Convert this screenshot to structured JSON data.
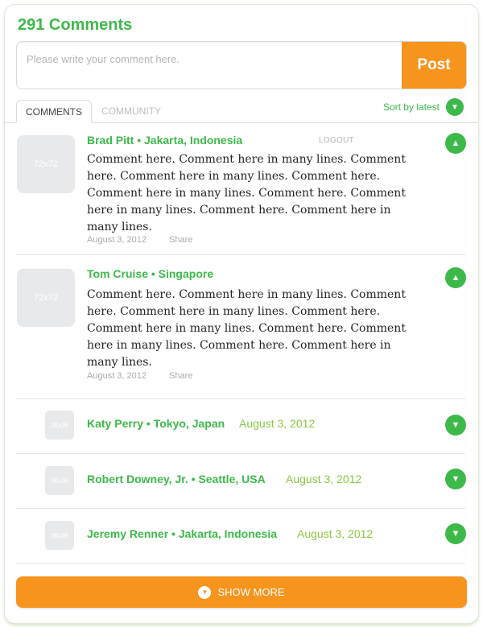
{
  "header": {
    "title": "291 Comments"
  },
  "composer": {
    "placeholder": "Please write your comment here.",
    "post_label": "Post"
  },
  "tabs": [
    {
      "label": "COMMENTS",
      "active": true
    },
    {
      "label": "COMMUNITY",
      "active": false
    }
  ],
  "sort": {
    "label": "Sort by latest",
    "icon": "chevron-down-icon"
  },
  "comments": [
    {
      "avatar": "72x72",
      "author": "Brad Pitt • Jakarta, Indonesia",
      "logout": "LOGOUT",
      "text": "Comment here. Comment here in many lines. Comment here. Comment here in many lines. Comment here. Comment here in many lines. Comment here. Comment here in many lines. Comment here. Comment here in many lines.",
      "date": "August 3, 2012",
      "share": "Share",
      "vote_icon": "up-icon"
    },
    {
      "avatar": "72x72",
      "author": "Tom Cruise • Singapore",
      "text": "Comment here. Comment here in many lines. Comment here. Comment here in many lines. Comment here. Comment here in many lines. Comment here. Comment here in many lines. Comment here. Comment here in many lines.",
      "date": "August 3, 2012",
      "share": "Share",
      "vote_icon": "up-icon"
    }
  ],
  "replies": [
    {
      "avatar": "36x36",
      "author": "Katy Perry • Tokyo, Japan",
      "date": "August 3, 2012",
      "vote_icon": "down-icon"
    },
    {
      "avatar": "36x36",
      "author": "Robert Downey, Jr. • Seattle, USA",
      "date": "August 3, 2012",
      "vote_icon": "down-icon"
    },
    {
      "avatar": "36x36",
      "author": "Jeremy Renner • Jakarta, Indonesia",
      "date": "August 3, 2012",
      "vote_icon": "down-icon"
    }
  ],
  "show_more": {
    "label": "SHOW MORE"
  },
  "colors": {
    "accent_green": "#3db94a",
    "accent_orange": "#f7941d",
    "date_green": "#8cc63f"
  }
}
